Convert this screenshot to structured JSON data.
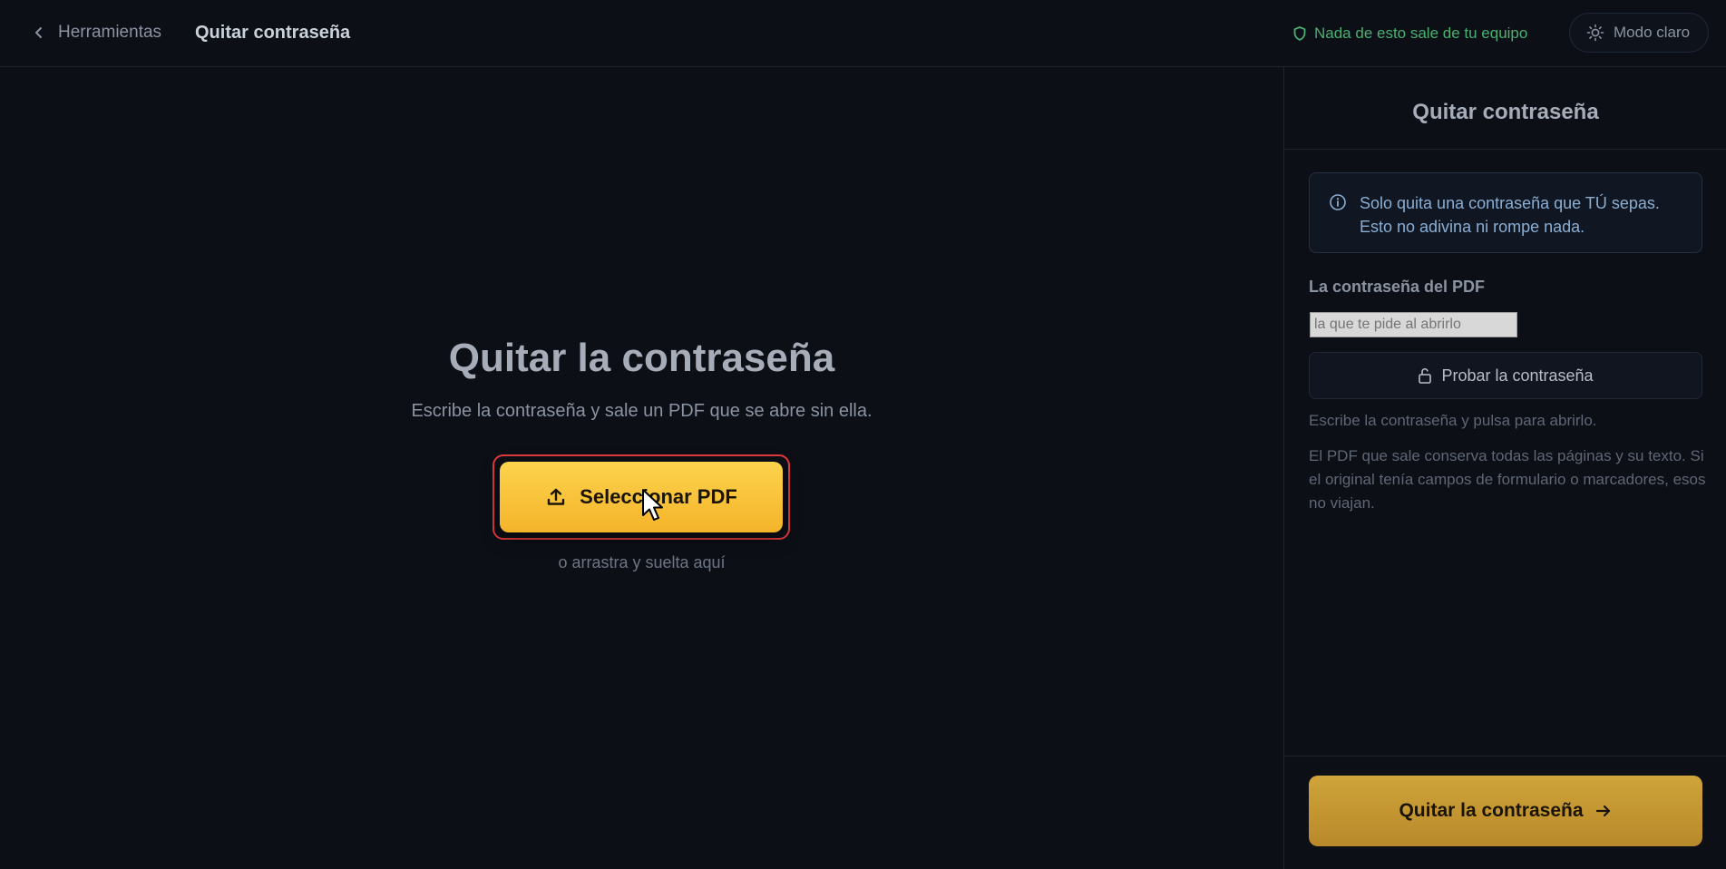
{
  "header": {
    "back_label": "Herramientas",
    "title": "Quitar contraseña",
    "privacy_note": "Nada de esto sale de tu equipo",
    "theme_toggle_label": "Modo claro"
  },
  "main": {
    "title": "Quitar la contraseña",
    "subtitle": "Escribe la contraseña y sale un PDF que se abre sin ella.",
    "select_button_label": "Seleccionar PDF",
    "drop_hint": "o arrastra y suelta aquí"
  },
  "panel": {
    "title": "Quitar contraseña",
    "info_text_line1": "Solo quita una contraseña que TÚ sepas.",
    "info_text_line2": "Esto no adivina ni rompe nada.",
    "password_label": "La contraseña del PDF",
    "password_placeholder": "la que te pide al abrirlo",
    "password_value": "",
    "test_button_label": "Probar la contraseña",
    "hint_line": "Escribe la contraseña y pulsa para abrirlo.",
    "note": "El PDF que sale conserva todas las páginas y su texto. Si el original tenía campos de formulario o marcadores, esos no viajan.",
    "submit_label": "Quitar la contraseña"
  },
  "colors": {
    "accent": "#f4b42a",
    "privacy_green": "#4caf72",
    "info_blue": "#8aaed3",
    "highlight_red": "#e23b3b"
  },
  "icons": {
    "back": "chevron-left-icon",
    "privacy": "shield-icon",
    "theme": "sun-icon",
    "upload": "upload-icon",
    "info": "info-circle-icon",
    "test": "unlock-icon",
    "submit": "arrow-right-icon",
    "pointer": "mouse-pointer-icon"
  }
}
